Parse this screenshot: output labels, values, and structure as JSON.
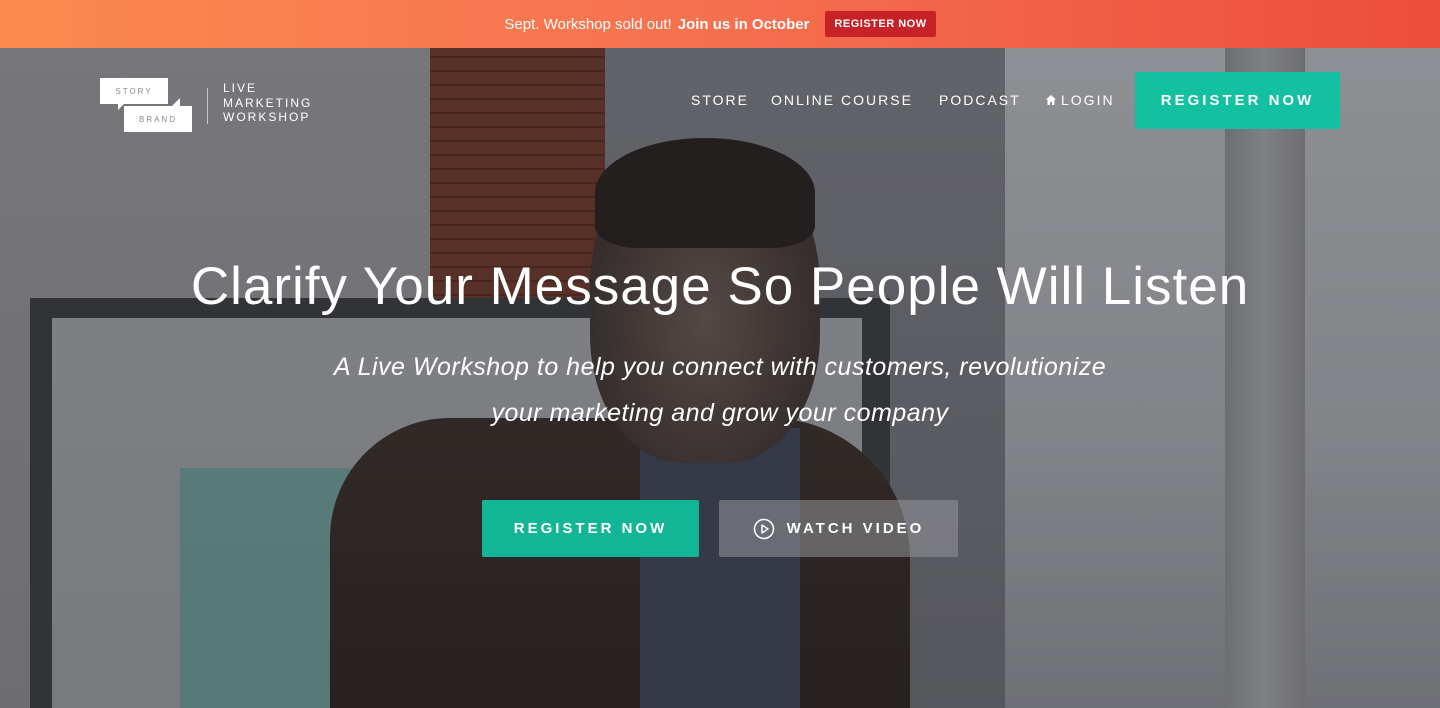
{
  "announcement": {
    "text": "Sept. Workshop sold out!",
    "bold_text": "Join us in October",
    "cta_label": "REGISTER NOW"
  },
  "logo": {
    "top_word": "STORY",
    "bottom_word": "BRAND",
    "tagline_1": "LIVE",
    "tagline_2": "MARKETING",
    "tagline_3": "WORKSHOP"
  },
  "nav": {
    "items": [
      {
        "label": "STORE"
      },
      {
        "label": "ONLINE COURSE"
      },
      {
        "label": "PODCAST"
      },
      {
        "label": "LOGIN",
        "icon": "home-icon"
      }
    ],
    "cta_label": "REGISTER NOW"
  },
  "hero": {
    "headline": "Clarify Your Message So People Will Listen",
    "sub_line_1": "A Live Workshop to help you connect with customers, revolutionize",
    "sub_line_2": "your marketing and grow your company",
    "primary_cta": "REGISTER NOW",
    "secondary_cta": "WATCH VIDEO",
    "secondary_icon": "play-circle-icon"
  },
  "colors": {
    "accent": "#13c0a0",
    "announce_start": "#fb8a4f",
    "announce_end": "#ec4d3d",
    "announce_cta": "#c62228"
  }
}
